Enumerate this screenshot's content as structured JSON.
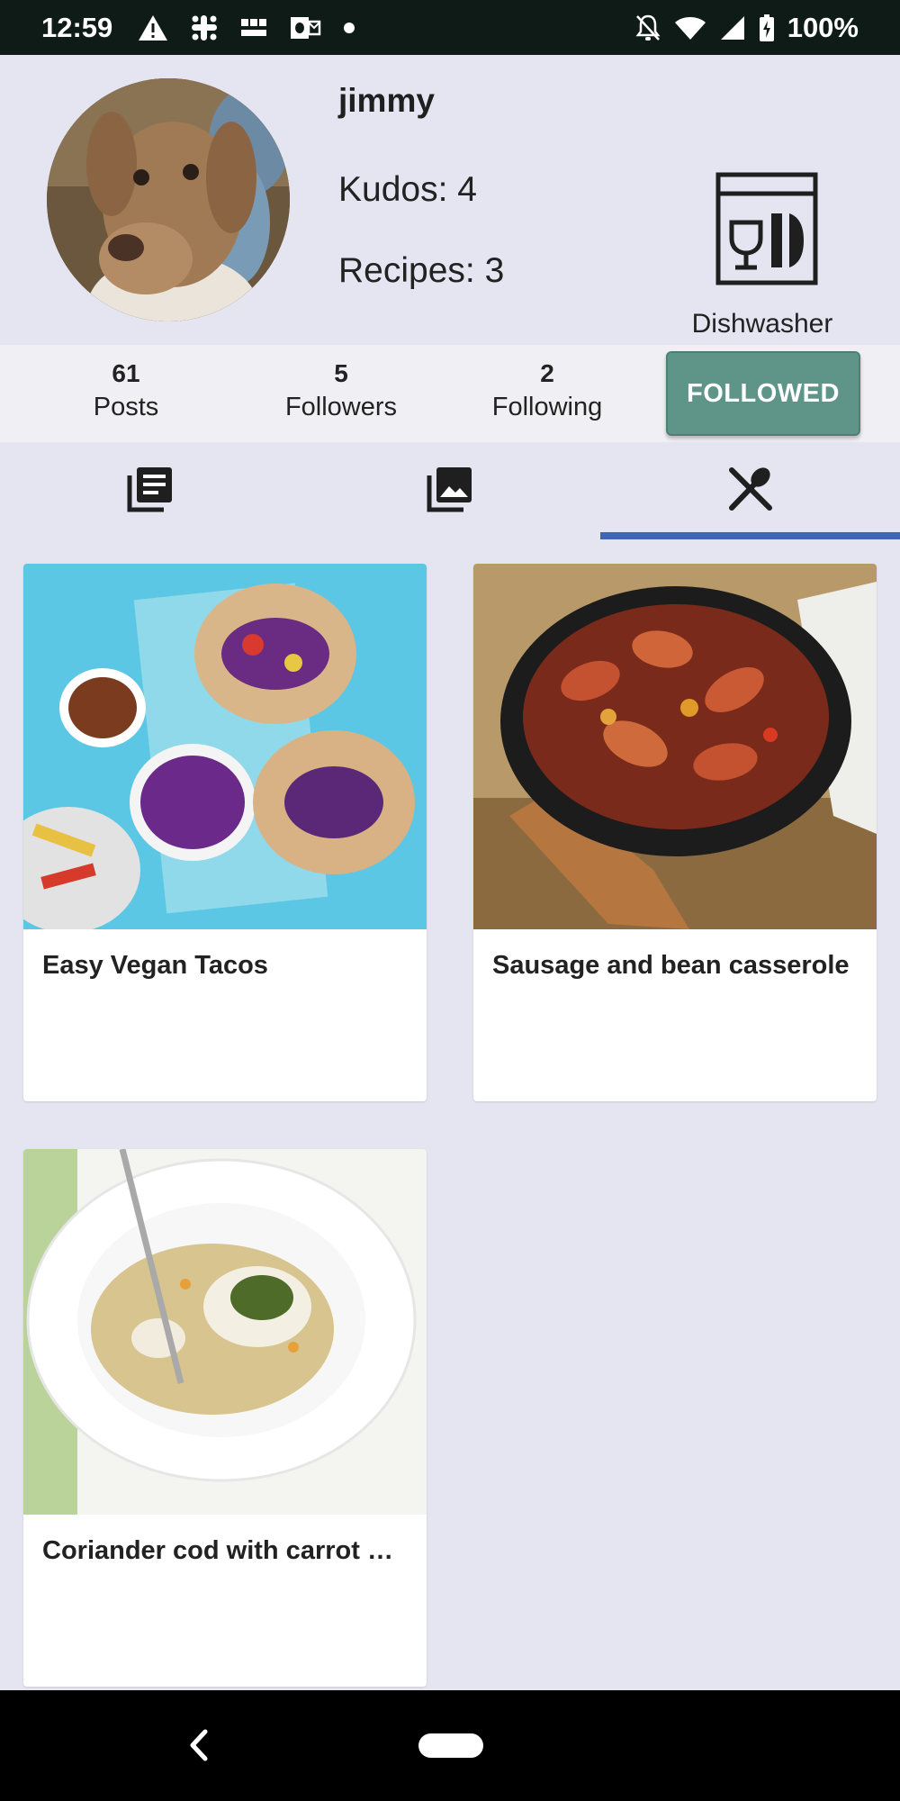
{
  "status_bar": {
    "time": "12:59",
    "battery": "100%",
    "notification_icons": [
      "warning-icon",
      "slack-icon",
      "bbc-news-icon",
      "outlook-icon",
      "dot-icon"
    ],
    "system_icons": [
      "notifications-off-icon",
      "wifi-icon",
      "cellular-icon",
      "battery-icon"
    ]
  },
  "profile": {
    "username": "jimmy",
    "kudos": "Kudos: 4",
    "recipes": "Recipes: 3",
    "badge": {
      "icon": "dishwasher-icon",
      "label": "Dishwasher"
    }
  },
  "stats": [
    {
      "count": "61",
      "label": "Posts"
    },
    {
      "count": "5",
      "label": "Followers"
    },
    {
      "count": "2",
      "label": "Following"
    }
  ],
  "follow_button": {
    "label": "FOLLOWED",
    "color": "#5f9488"
  },
  "tabs": [
    {
      "icon": "posts-list-icon",
      "selected": false
    },
    {
      "icon": "photo-library-icon",
      "selected": false
    },
    {
      "icon": "fork-spoon-icon",
      "selected": true
    }
  ],
  "tab_indicator_color": "#3f65b8",
  "recipe_cards": [
    {
      "title": "Easy Vegan Tacos"
    },
    {
      "title": "Sausage and bean casserole"
    },
    {
      "title": "Coriander cod with carrot pi…"
    }
  ],
  "nav_bar": {
    "icons": [
      "back-icon",
      "home-pill-icon"
    ]
  }
}
